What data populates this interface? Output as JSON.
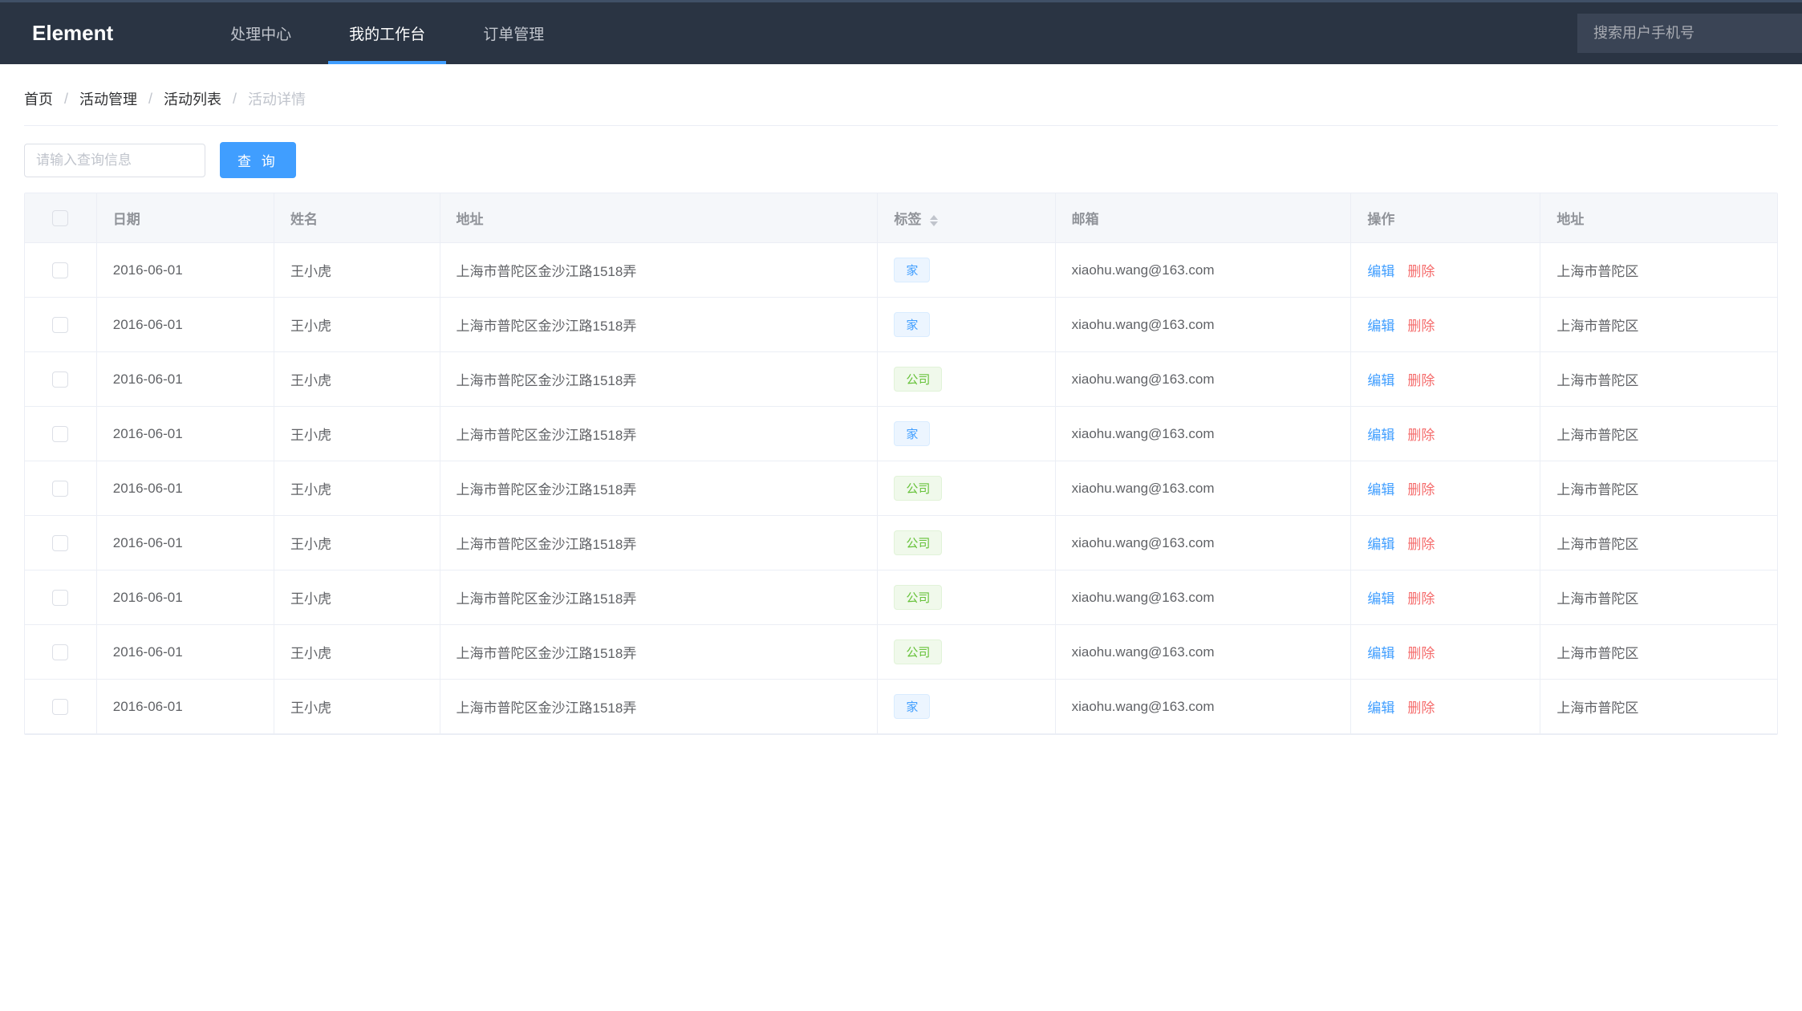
{
  "header": {
    "logo": "Element",
    "nav": [
      {
        "label": "处理中心",
        "active": false
      },
      {
        "label": "我的工作台",
        "active": true
      },
      {
        "label": "订单管理",
        "active": false
      }
    ],
    "search_placeholder": "搜索用户手机号"
  },
  "breadcrumb": {
    "items": [
      "首页",
      "活动管理",
      "活动列表",
      "活动详情"
    ]
  },
  "query": {
    "input_placeholder": "请输入查询信息",
    "button_label": "查 询"
  },
  "table": {
    "columns": {
      "date": "日期",
      "name": "姓名",
      "address": "地址",
      "tag": "标签",
      "email": "邮箱",
      "ops": "操作",
      "address2": "地址"
    },
    "ops": {
      "edit": "编辑",
      "delete": "删除"
    },
    "tags": {
      "home": "家",
      "office": "公司"
    },
    "rows": [
      {
        "date": "2016-06-01",
        "name": "王小虎",
        "address": "上海市普陀区金沙江路1518弄",
        "tag": "home",
        "email": "xiaohu.wang@163.com",
        "address2": "上海市普陀区"
      },
      {
        "date": "2016-06-01",
        "name": "王小虎",
        "address": "上海市普陀区金沙江路1518弄",
        "tag": "home",
        "email": "xiaohu.wang@163.com",
        "address2": "上海市普陀区"
      },
      {
        "date": "2016-06-01",
        "name": "王小虎",
        "address": "上海市普陀区金沙江路1518弄",
        "tag": "office",
        "email": "xiaohu.wang@163.com",
        "address2": "上海市普陀区"
      },
      {
        "date": "2016-06-01",
        "name": "王小虎",
        "address": "上海市普陀区金沙江路1518弄",
        "tag": "home",
        "email": "xiaohu.wang@163.com",
        "address2": "上海市普陀区"
      },
      {
        "date": "2016-06-01",
        "name": "王小虎",
        "address": "上海市普陀区金沙江路1518弄",
        "tag": "office",
        "email": "xiaohu.wang@163.com",
        "address2": "上海市普陀区"
      },
      {
        "date": "2016-06-01",
        "name": "王小虎",
        "address": "上海市普陀区金沙江路1518弄",
        "tag": "office",
        "email": "xiaohu.wang@163.com",
        "address2": "上海市普陀区"
      },
      {
        "date": "2016-06-01",
        "name": "王小虎",
        "address": "上海市普陀区金沙江路1518弄",
        "tag": "office",
        "email": "xiaohu.wang@163.com",
        "address2": "上海市普陀区"
      },
      {
        "date": "2016-06-01",
        "name": "王小虎",
        "address": "上海市普陀区金沙江路1518弄",
        "tag": "office",
        "email": "xiaohu.wang@163.com",
        "address2": "上海市普陀区"
      },
      {
        "date": "2016-06-01",
        "name": "王小虎",
        "address": "上海市普陀区金沙江路1518弄",
        "tag": "home",
        "email": "xiaohu.wang@163.com",
        "address2": "上海市普陀区"
      }
    ]
  }
}
